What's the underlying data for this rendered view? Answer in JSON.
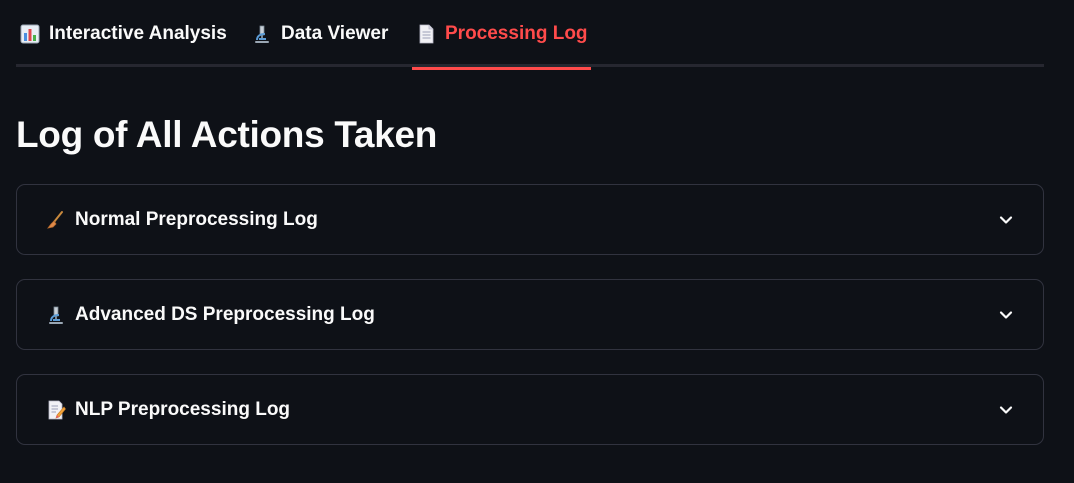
{
  "tabs": [
    {
      "label": "Interactive Analysis",
      "icon": "bar-chart-icon",
      "active": false
    },
    {
      "label": "Data Viewer",
      "icon": "microscope-icon",
      "active": false
    },
    {
      "label": "Processing Log",
      "icon": "page-icon",
      "active": true
    }
  ],
  "page": {
    "title": "Log of All Actions Taken"
  },
  "expanders": [
    {
      "label": "Normal Preprocessing Log",
      "icon": "broom-icon"
    },
    {
      "label": "Advanced DS Preprocessing Log",
      "icon": "microscope-icon"
    },
    {
      "label": "NLP Preprocessing Log",
      "icon": "memo-icon"
    }
  ],
  "colors": {
    "background": "#0e1117",
    "accent": "#ff4b4b",
    "text": "#fafafa",
    "border": "#31333f",
    "tab_rule": "#262730"
  }
}
